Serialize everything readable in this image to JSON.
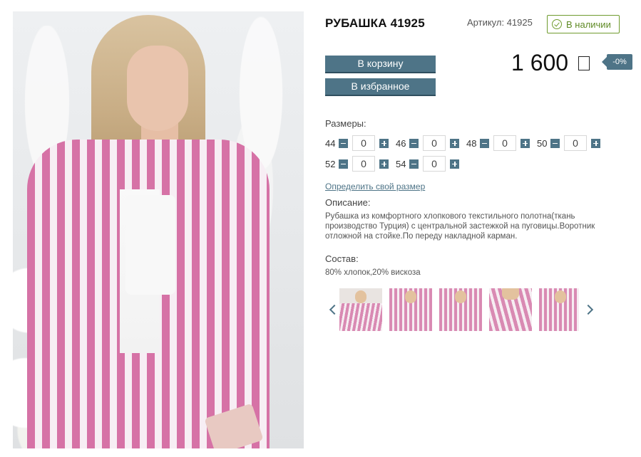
{
  "product": {
    "title": "РУБАШКА 41925",
    "article": "Артикул: 41925",
    "stock": "В наличии"
  },
  "buttons": {
    "cart": "В корзину",
    "favorite": "В избранное"
  },
  "price": {
    "value": "1 600",
    "currency_icon": "ruble-sign",
    "discount": "-0%"
  },
  "sizes": {
    "label": "Размеры:",
    "rows": [
      [
        {
          "size": "44",
          "qty": "0"
        },
        {
          "size": "46",
          "qty": "0"
        },
        {
          "size": "48",
          "qty": "0"
        },
        {
          "size": "50",
          "qty": "0"
        }
      ],
      [
        {
          "size": "52",
          "qty": "0"
        },
        {
          "size": "54",
          "qty": "0"
        }
      ]
    ],
    "size_link": "Определить свой размер"
  },
  "description": {
    "label": "Описание:",
    "text": "Рубашка из комфортного хлопкового текстильного полотна(ткань производство Турция) с центральной застежкой на пуговицы.Воротник отложной на стойке.По переду накладной карман."
  },
  "composition": {
    "label": "Состав:",
    "text": "80% хлопок,20% вискоза"
  },
  "gallery": {
    "thumb_count": 5
  },
  "colors": {
    "accent": "#4e7487",
    "stock_green": "#6f9b2e",
    "stripe_pink": "#d672a6"
  }
}
